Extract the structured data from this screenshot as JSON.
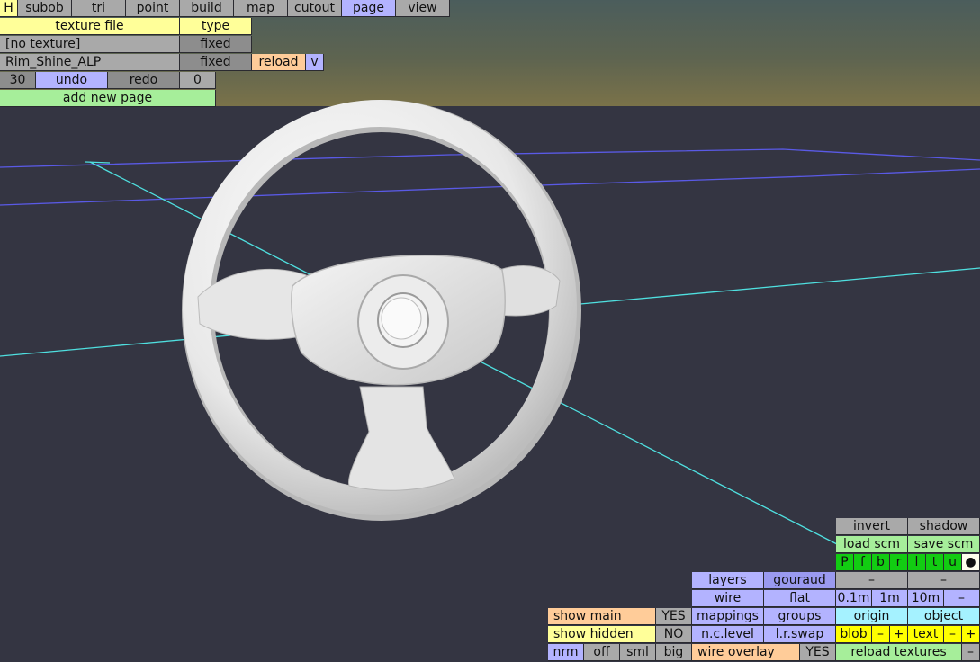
{
  "toolbar": {
    "tabs": [
      {
        "id": "h",
        "label": "H"
      },
      {
        "id": "subob",
        "label": "subob"
      },
      {
        "id": "tri",
        "label": "tri"
      },
      {
        "id": "point",
        "label": "point"
      },
      {
        "id": "build",
        "label": "build"
      },
      {
        "id": "map",
        "label": "map"
      },
      {
        "id": "cutout",
        "label": "cutout"
      },
      {
        "id": "page",
        "label": "page"
      },
      {
        "id": "view",
        "label": "view"
      }
    ],
    "active_tab": "page"
  },
  "page_panel": {
    "header_texture": "texture file",
    "header_type": "type",
    "rows": [
      {
        "texture": "[no texture]",
        "type": "fixed"
      },
      {
        "texture": "Rim_Shine_ALP",
        "type": "fixed"
      }
    ],
    "reload_label": "reload",
    "v_label": "v",
    "undo_count": "30",
    "undo_label": "undo",
    "redo_label": "redo",
    "redo_count": "0",
    "add_page_label": "add new page"
  },
  "view_panel": {
    "invert": "invert",
    "shadow": "shadow",
    "load_scm": "load scm",
    "save_scm": "save scm",
    "views": [
      "P",
      "f",
      "b",
      "r",
      "l",
      "t",
      "u",
      "●"
    ],
    "minus": "–",
    "layers": "layers",
    "gouraud": "gouraud",
    "wire": "wire",
    "flat": "flat",
    "grid_01": "0.1m",
    "grid_1": "1m",
    "grid_10": "10m",
    "mappings": "mappings",
    "groups": "groups",
    "origin": "origin",
    "object": "object",
    "show_main": "show main",
    "show_main_val": "YES",
    "show_hidden": "show hidden",
    "show_hidden_val": "NO",
    "nc_level": "n.c.level",
    "lr_swap": "l.r.swap",
    "blob": "blob",
    "plus": "+",
    "text": "text",
    "nrm": "nrm",
    "off": "off",
    "sml": "sml",
    "big": "big",
    "wire_overlay": "wire overlay",
    "wire_overlay_val": "YES",
    "reload_textures": "reload textures"
  }
}
